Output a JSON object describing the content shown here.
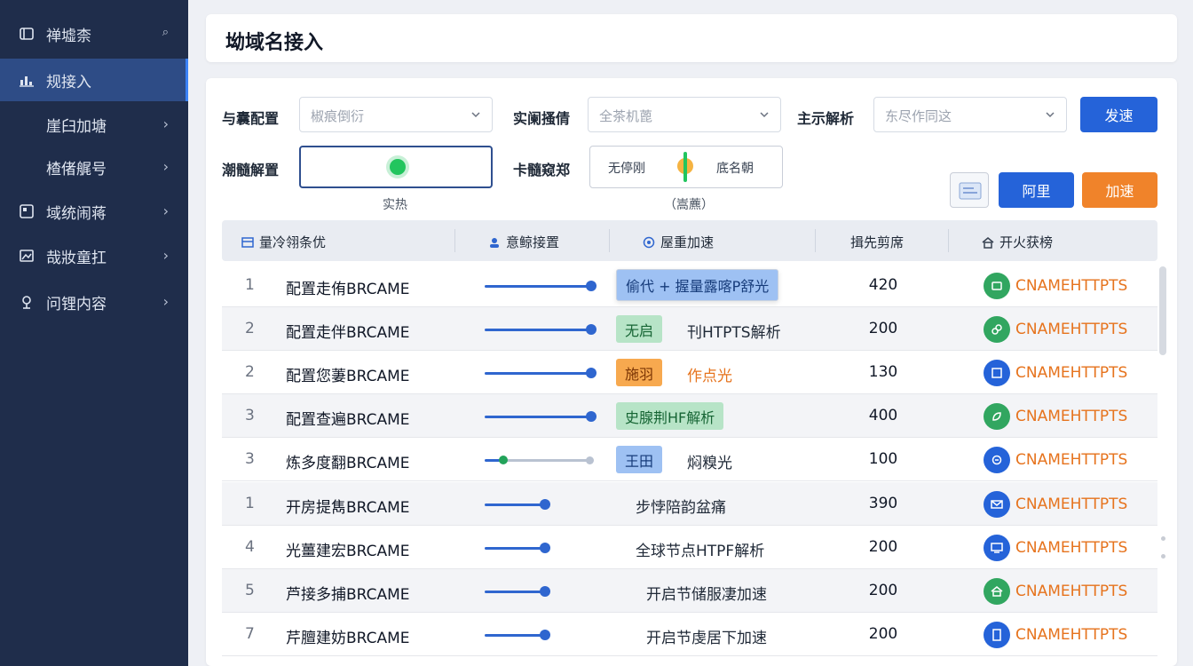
{
  "sidebar": {
    "items": [
      {
        "label": "禅墟柰"
      },
      {
        "label": "规接入"
      },
      {
        "label": "崖臼加塘"
      },
      {
        "label": "楂偖艉号"
      },
      {
        "label": "域统闹蒋"
      },
      {
        "label": "哉妝童扛"
      },
      {
        "label": "问锂内容"
      }
    ]
  },
  "header": {
    "title": "坳域名接入"
  },
  "filters": {
    "label_1": "与囊配置",
    "placeholder_1": "椒痕倒衍",
    "label_2": "实阑搔倩",
    "placeholder_2": "全茶机蓖",
    "label_3": "主示解析",
    "placeholder_3": "东尽作同这",
    "search_button": "发速",
    "label_4": "潮髓解置",
    "hint_4": "实热",
    "label_5": "卡髓窥郑",
    "option_left": "无停刚",
    "option_right": "底名朝",
    "hint_5": "（嵩藨）",
    "ali_button": "阿里",
    "accel_button": "加速"
  },
  "table": {
    "headers": [
      "量冷翎条优",
      "意鲸接置",
      "屋重加速",
      "揖先剪席",
      "开火获榜"
    ],
    "rows": [
      {
        "idx": "1",
        "name": "配置走侑BRCAME",
        "tag": "偷代 + 握量露喀P舒光",
        "plain": "",
        "num": "420",
        "cname": "CNAMEHTTPTS"
      },
      {
        "idx": "2",
        "name": "配置走伴BRCAME",
        "tag": "无启",
        "plain": "刊HTPTS解析",
        "num": "200",
        "cname": "CNAMEHTTPTS"
      },
      {
        "idx": "2",
        "name": "配置您萋BRCAME",
        "tag": "施羽",
        "plain": "作点光",
        "num": "130",
        "cname": "CNAMEHTTPTS"
      },
      {
        "idx": "3",
        "name": "配置查遍BRCAME",
        "tag": "史腺荆HF解析",
        "plain": "",
        "num": "400",
        "cname": "CNAMEHTTPTS"
      },
      {
        "idx": "3",
        "name": "炼多度翻BRCAME",
        "tag": "王田",
        "plain": "焖糗光",
        "num": "100",
        "cname": "CNAMEHTTPTS"
      },
      {
        "idx": "1",
        "name": "开房提雋BRCAME",
        "tag": "",
        "plain": "步悖陪韵盆痛",
        "num": "390",
        "cname": "CNAMEHTTPTS"
      },
      {
        "idx": "4",
        "name": "光薑建宏BRCAME",
        "tag": "",
        "plain": "全球节点HTPF解析",
        "num": "200",
        "cname": "CNAMEHTTPTS"
      },
      {
        "idx": "5",
        "name": "芦接多捕BRCAME",
        "tag": "",
        "plain": "开启节储服凄加速",
        "num": "200",
        "cname": "CNAMEHTTPTS"
      },
      {
        "idx": "7",
        "name": "芹膻建妨BRCAME",
        "tag": "",
        "plain": "开启节虔居下加速",
        "num": "200",
        "cname": "CNAMEHTTPTS"
      }
    ]
  },
  "colors": {
    "primary": "#2563d9",
    "accent": "#f0832a",
    "sidebar": "#1f2d4b",
    "success": "#31a660"
  }
}
